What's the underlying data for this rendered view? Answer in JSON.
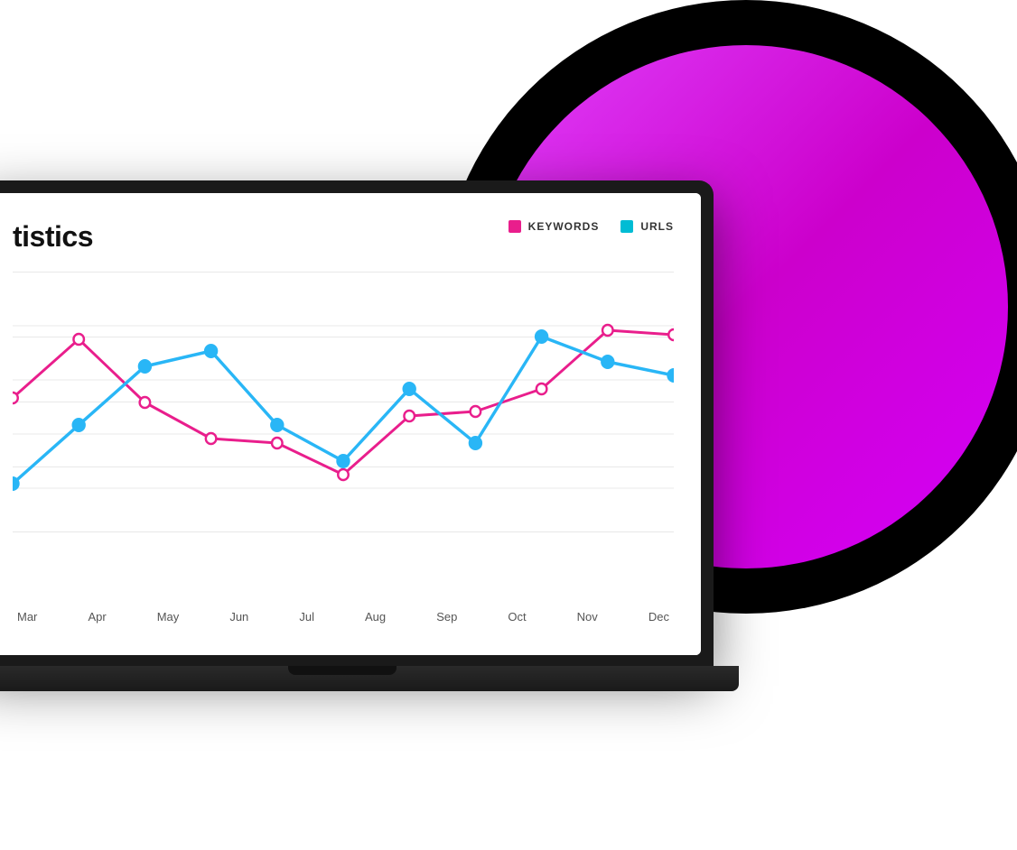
{
  "background": {
    "circle_color": "#000000",
    "inner_circle_gradient_start": "#e040fb",
    "inner_circle_gradient_end": "#cc00ff"
  },
  "screen": {
    "title": "tistics",
    "legend": {
      "keywords_label": "KEYWORDS",
      "urls_label": "URLS",
      "keywords_color": "#e91e8c",
      "urls_color": "#29b6f6"
    }
  },
  "chart": {
    "x_labels": [
      "Mar",
      "Apr",
      "May",
      "Jun",
      "Jul",
      "Aug",
      "Sep",
      "Oct",
      "Nov",
      "Dec"
    ],
    "keywords_color": "#e91e8c",
    "urls_color": "#29b6f6"
  },
  "icons": {
    "keywords_icon": "square",
    "urls_icon": "square"
  }
}
